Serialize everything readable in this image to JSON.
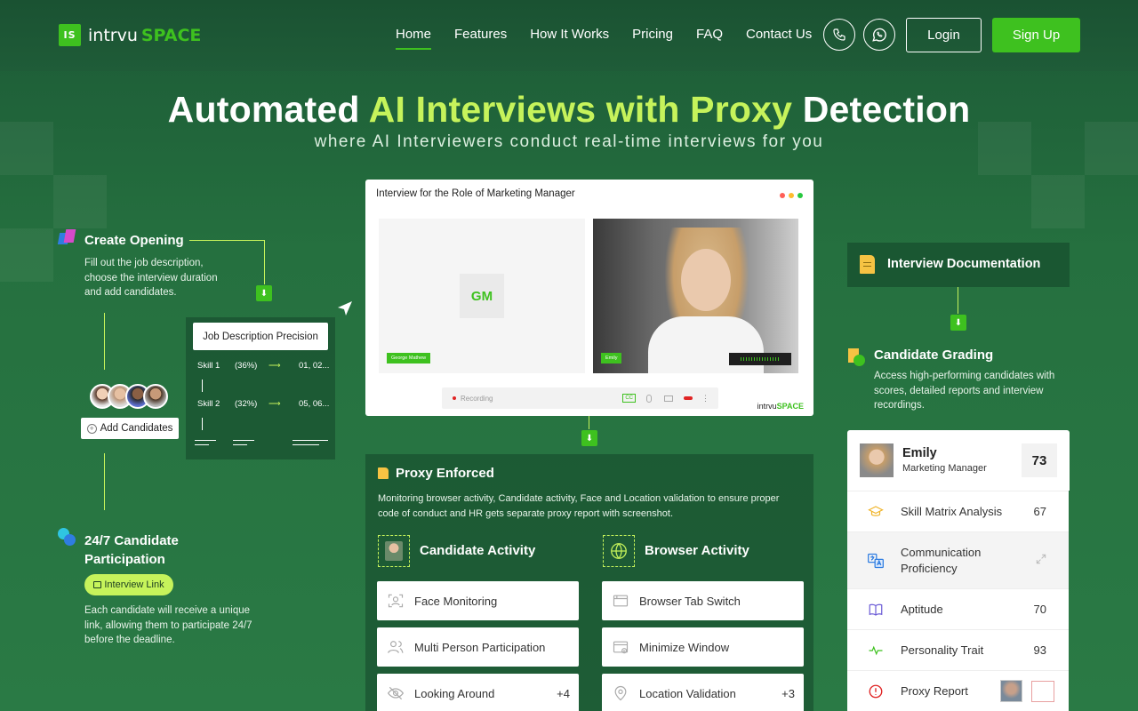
{
  "brand": {
    "mark": "IS",
    "name_part1": "intrvu",
    "name_part2": "SPACE"
  },
  "nav": {
    "items": [
      "Home",
      "Features",
      "How It Works",
      "Pricing",
      "FAQ",
      "Contact Us"
    ],
    "login_label": "Login",
    "signup_label": "Sign Up"
  },
  "hero": {
    "title_pre": "Automated",
    "title_highlight": "AI Interviews with Proxy",
    "title_post": "Detection",
    "subtitle": "where AI Interviewers conduct real-time interviews for you"
  },
  "steps": {
    "create_opening": {
      "title": "Create Opening",
      "desc": "Fill out the job description, choose the interview duration and add candidates."
    },
    "job_desc_card": {
      "title": "Job Description Precision",
      "rows": [
        {
          "skill": "Skill 1",
          "pct": "(36%)",
          "val": "01, 02..."
        },
        {
          "skill": "Skill 2",
          "pct": "(32%)",
          "val": "05, 06..."
        }
      ]
    },
    "add_candidates_label": "Add Candidates",
    "participation": {
      "title": "24/7 Candidate Participation",
      "badge": "Interview Link",
      "desc": "Each candidate will receive a unique link, allowing them to participate 24/7 before the deadline."
    }
  },
  "interview": {
    "title": "Interview for the Role of Marketing Manager",
    "interviewer_initials": "GM",
    "interviewer_name": "George Mathew",
    "candidate_name": "Emily",
    "recording_label": "Recording",
    "cc_label": "CC",
    "footer_brand_1": "intrvu",
    "footer_brand_2": "SPACE"
  },
  "proxy": {
    "title": "Proxy Enforced",
    "desc": "Monitoring browser activity, Candidate activity, Face and Location validation to ensure proper code of conduct and HR gets separate proxy report with screenshot.",
    "candidate_activity": {
      "title": "Candidate Activity",
      "items": [
        {
          "label": "Face Monitoring",
          "count": ""
        },
        {
          "label": "Multi Person Participation",
          "count": ""
        },
        {
          "label": "Looking Around",
          "count": "+4"
        }
      ]
    },
    "browser_activity": {
      "title": "Browser Activity",
      "items": [
        {
          "label": "Browser Tab Switch",
          "count": ""
        },
        {
          "label": "Minimize Window",
          "count": ""
        },
        {
          "label": "Location Validation",
          "count": "+3"
        }
      ]
    }
  },
  "documentation": {
    "title": "Interview Documentation"
  },
  "grading": {
    "title": "Candidate Grading",
    "desc": "Access high-performing candidates with scores, detailed reports and interview recordings.",
    "candidate": {
      "name": "Emily",
      "role": "Marketing Manager",
      "score": "73"
    },
    "rows": [
      {
        "label": "Skill Matrix Analysis",
        "value": "67",
        "icon": "graduation-cap-icon",
        "color": "#f0b429"
      },
      {
        "label": "Communication Proficiency",
        "value": "",
        "icon": "translate-icon",
        "color": "#2f7de1"
      },
      {
        "label": "Aptitude",
        "value": "70",
        "icon": "book-icon",
        "color": "#6b5bd6"
      },
      {
        "label": "Personality Trait",
        "value": "93",
        "icon": "pulse-icon",
        "color": "#3ec11f"
      },
      {
        "label": "Proxy Report",
        "value": "",
        "icon": "alert-icon",
        "color": "#e02424"
      }
    ]
  },
  "colors": {
    "accent": "#3ec11f",
    "highlight": "#c6f35b",
    "bg": "#25703f"
  }
}
